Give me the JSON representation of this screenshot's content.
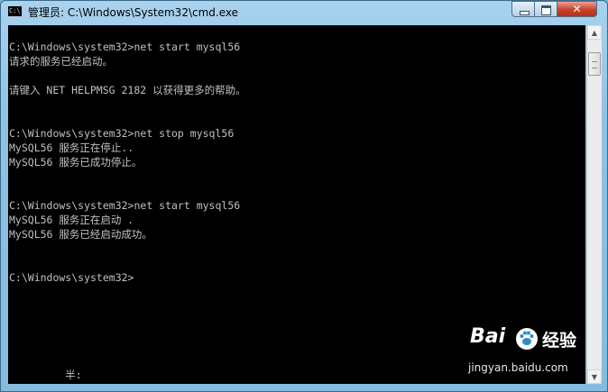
{
  "window": {
    "title": "管理员: C:\\Windows\\System32\\cmd.exe",
    "icon_text": "C:\\"
  },
  "console": {
    "lines": [
      "C:\\Windows\\system32>net start mysql56",
      "请求的服务已经启动。",
      "",
      "请键入 NET HELPMSG 2182 以获得更多的帮助。",
      "",
      "",
      "C:\\Windows\\system32>net stop mysql56",
      "MySQL56 服务正在停止..",
      "MySQL56 服务已成功停止。",
      "",
      "",
      "C:\\Windows\\system32>net start mysql56",
      "MySQL56 服务正在启动 .",
      "MySQL56 服务已经启动成功。",
      "",
      "",
      "C:\\Windows\\system32>",
      "",
      "",
      "",
      "",
      "",
      "         半:"
    ]
  },
  "watermark": {
    "brand": "Bai",
    "brand2": "经验",
    "url": "jingyan.baidu.com"
  },
  "colors": {
    "console_bg": "#000000",
    "console_text": "#c0c0c0",
    "close_button": "#c7412b"
  }
}
